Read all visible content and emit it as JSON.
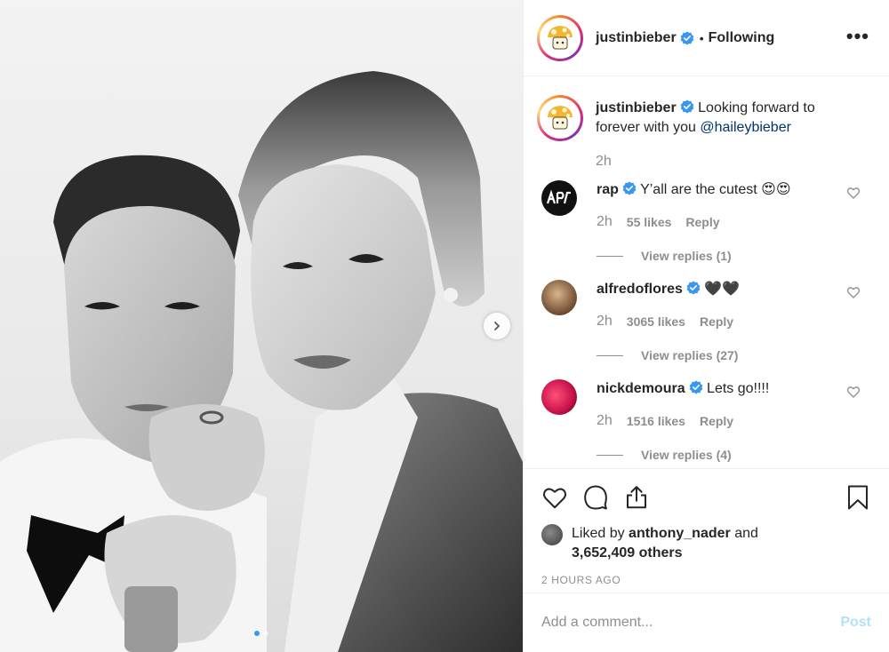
{
  "header": {
    "username": "justinbieber",
    "bullet": "•",
    "follow_state": "Following",
    "more_label": "•••"
  },
  "caption": {
    "username": "justinbieber",
    "text": "Looking forward to forever with you",
    "mention": "@haileybieber",
    "time": "2h"
  },
  "comments": [
    {
      "username": "rap",
      "text": "Y’all are the cutest",
      "emoji": "😍😍",
      "time": "2h",
      "likes": "55 likes",
      "reply": "Reply",
      "view_replies": "View replies (1)"
    },
    {
      "username": "alfredoflores",
      "text": "",
      "emoji": "🖤🖤",
      "time": "2h",
      "likes": "3065 likes",
      "reply": "Reply",
      "view_replies": "View replies (27)"
    },
    {
      "username": "nickdemoura",
      "text": "Lets go!!!!",
      "emoji": "",
      "time": "2h",
      "likes": "1516 likes",
      "reply": "Reply",
      "view_replies": "View replies (4)"
    }
  ],
  "likes": {
    "prefix": "Liked by",
    "user": "anthony_nader",
    "joiner": "and",
    "count": "3,652,409 others"
  },
  "timestamp": "2 HOURS AGO",
  "add_comment": {
    "placeholder": "Add a comment...",
    "post_label": "Post"
  },
  "colors": {
    "verified": "#3897f0",
    "mention": "#003569",
    "post_disabled": "#b2dffc",
    "secondary_text": "#8e8e8e"
  },
  "icons": [
    "heart-icon",
    "comment-icon",
    "share-icon",
    "bookmark-icon",
    "chevron-right-icon",
    "verified-badge-icon"
  ],
  "carousel": {
    "slides": 2,
    "active_index": 0
  }
}
